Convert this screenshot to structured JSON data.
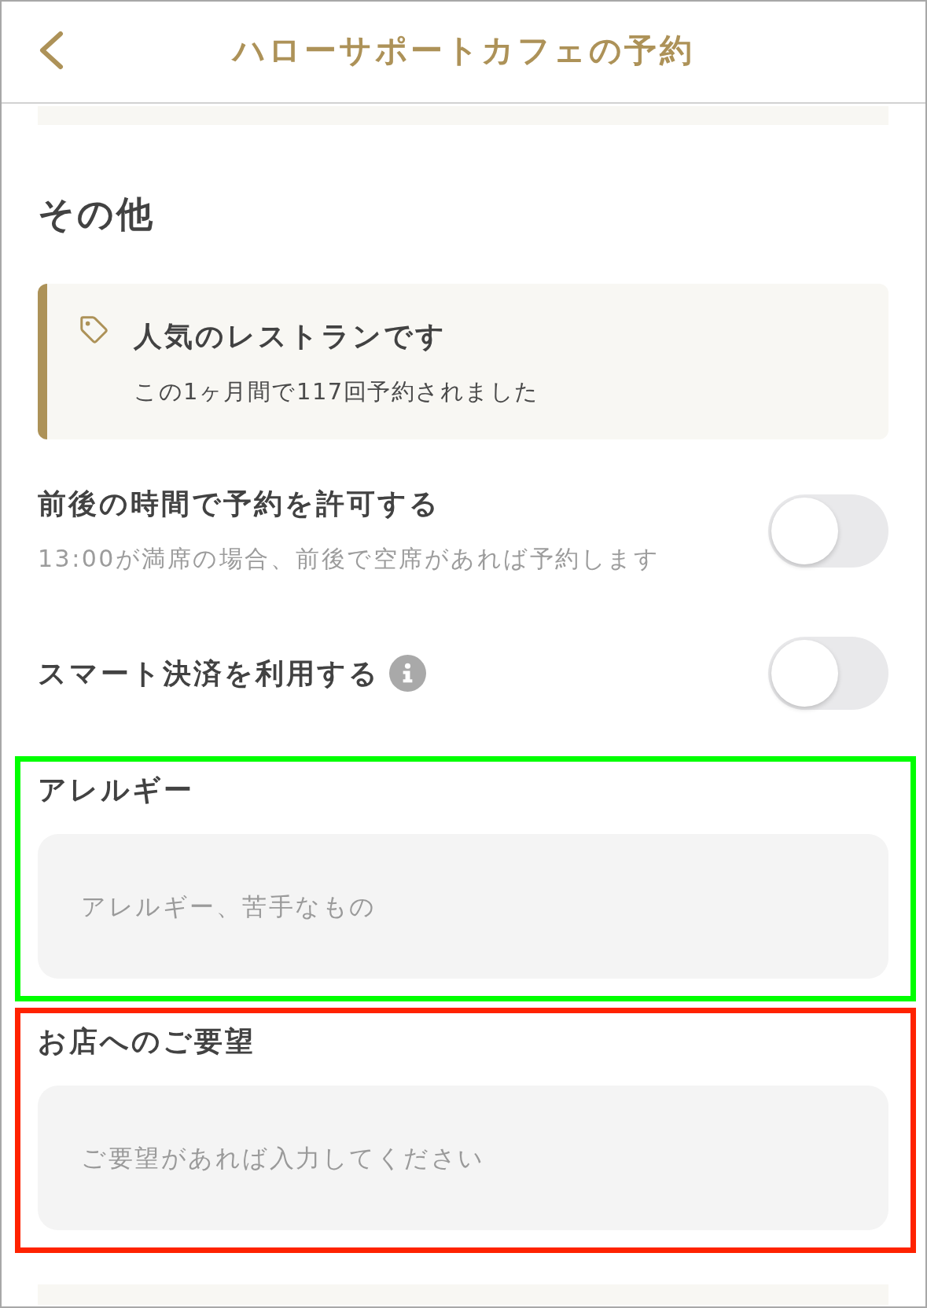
{
  "header": {
    "title": "ハローサポートカフェの予約"
  },
  "section": {
    "title": "その他"
  },
  "notice": {
    "title": "人気のレストランです",
    "text": "この1ヶ月間で117回予約されました"
  },
  "toggles": [
    {
      "label": "前後の時間で予約を許可する",
      "description": "13:00が満席の場合、前後で空席があれば予約します",
      "on": false,
      "info": false
    },
    {
      "label": "スマート決済を利用する",
      "on": false,
      "info": true
    }
  ],
  "fields": [
    {
      "label": "アレルギー",
      "placeholder": "アレルギー、苦手なもの",
      "color": "#00ff00"
    },
    {
      "label": "お店へのご要望",
      "placeholder": "ご要望があれば入力してください",
      "color": "#ff2200"
    }
  ]
}
